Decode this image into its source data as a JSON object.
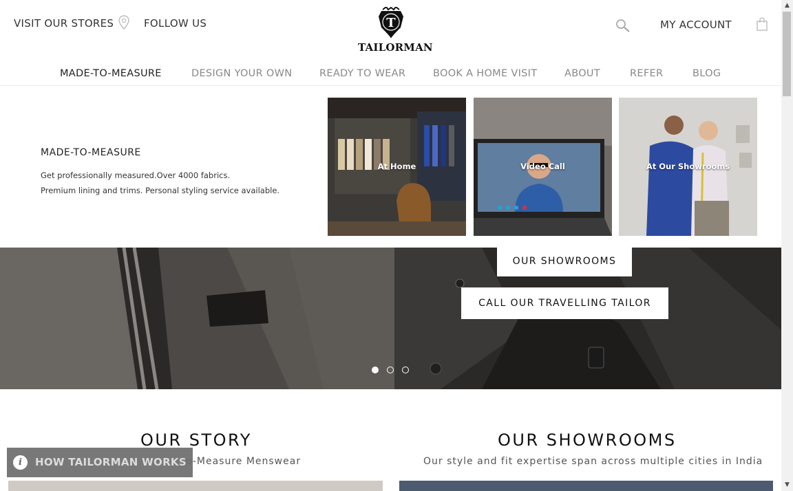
{
  "header": {
    "visit_stores": "VISIT OUR STORES",
    "follow_us": "FOLLOW US",
    "logo_letter": "T",
    "logo_text": "TAILORMAN",
    "my_account": "MY ACCOUNT"
  },
  "nav": {
    "items": [
      "MADE-TO-MEASURE",
      "DESIGN YOUR OWN",
      "READY TO WEAR",
      "BOOK A HOME VISIT",
      "ABOUT",
      "REFER",
      "BLOG"
    ],
    "active": "MADE-TO-MEASURE"
  },
  "mega_menu": {
    "title": "MADE-TO-MEASURE",
    "desc_line1": "Get professionally measured.Over 4000 fabrics.",
    "desc_line2": "Premium lining and trims. Personal styling service available.",
    "cards": [
      {
        "label": "At Home"
      },
      {
        "label": "Video Call"
      },
      {
        "label": "At Our Showrooms"
      }
    ]
  },
  "hero": {
    "button_showrooms": "OUR SHOWROOMS",
    "button_tailor": "CALL OUR TRAVELLING TAILOR",
    "slide_count": 3,
    "active_slide": 1
  },
  "sections": {
    "story": {
      "title": "OUR STORY",
      "subtitle": "o-Measure Menswear"
    },
    "showrooms": {
      "title": "OUR SHOWROOMS",
      "subtitle": "Our style and fit expertise span across multiple cities in India"
    }
  },
  "how_it_works": {
    "icon": "i",
    "label": "HOW TAILORMAN WORKS"
  },
  "colors": {
    "background": "#ffffff",
    "nav_active": "#222222",
    "nav_inactive": "#888888",
    "pill": "#6e6e6e"
  }
}
